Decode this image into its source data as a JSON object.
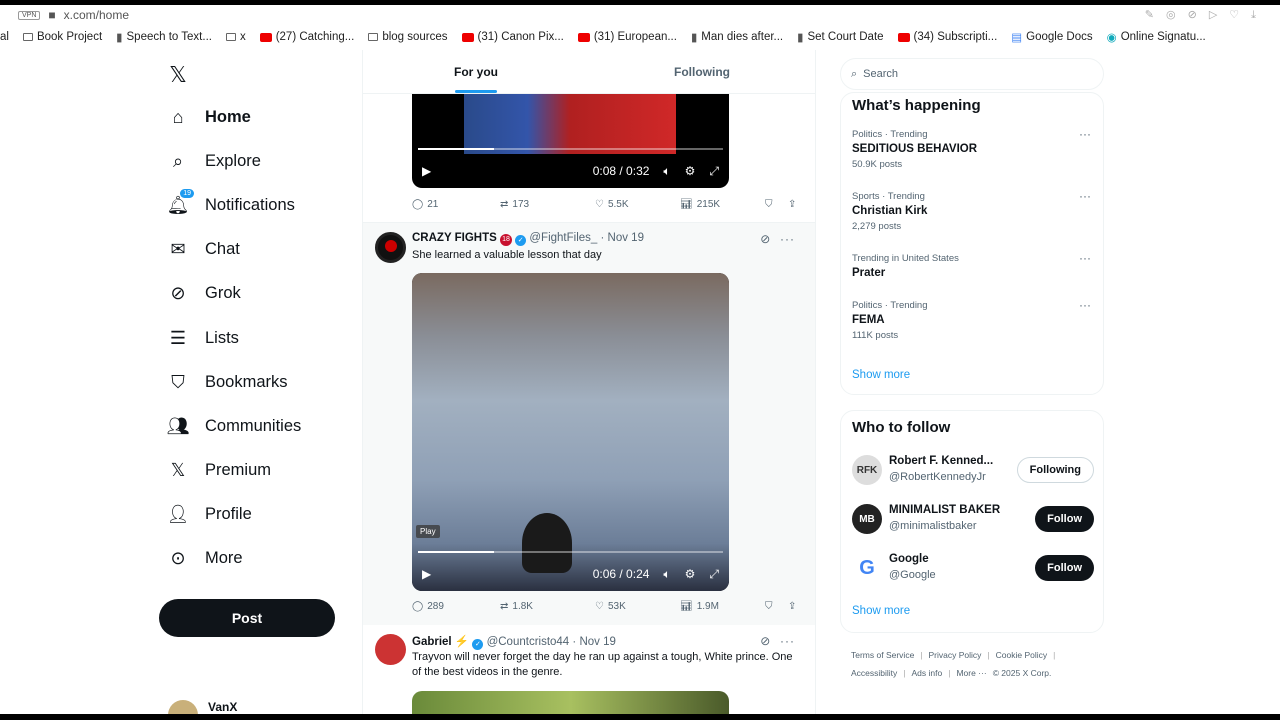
{
  "browser": {
    "url": "x.com/home",
    "vpn": "VPN",
    "bookmarks": [
      {
        "label": "al",
        "icon": "none"
      },
      {
        "label": "Book Project",
        "icon": "folder"
      },
      {
        "label": "Speech to Text...",
        "icon": "page"
      },
      {
        "label": "x",
        "icon": "folder"
      },
      {
        "label": "(27) Catching...",
        "icon": "youtube"
      },
      {
        "label": "blog sources",
        "icon": "folder"
      },
      {
        "label": "(31) Canon Pix...",
        "icon": "youtube"
      },
      {
        "label": "(31) European...",
        "icon": "youtube"
      },
      {
        "label": "Man dies after...",
        "icon": "news"
      },
      {
        "label": "Set Court Date",
        "icon": "doc"
      },
      {
        "label": "(34) Subscripti...",
        "icon": "youtube"
      },
      {
        "label": "Google Docs",
        "icon": "docs"
      },
      {
        "label": "Online Signatu...",
        "icon": "sign"
      }
    ]
  },
  "nav": {
    "items": [
      {
        "label": "Home",
        "icon": "home-icon",
        "glyph": "⌂"
      },
      {
        "label": "Explore",
        "icon": "search-icon",
        "glyph": "⌕"
      },
      {
        "label": "Notifications",
        "icon": "bell-icon",
        "glyph": "🔔︎",
        "badge": "19"
      },
      {
        "label": "Chat",
        "icon": "mail-icon",
        "glyph": "✉"
      },
      {
        "label": "Grok",
        "icon": "grok-icon",
        "glyph": "⊘"
      },
      {
        "label": "Lists",
        "icon": "list-icon",
        "glyph": "☰"
      },
      {
        "label": "Bookmarks",
        "icon": "bookmark-icon",
        "glyph": "⛉"
      },
      {
        "label": "Communities",
        "icon": "people-icon",
        "glyph": "👥︎"
      },
      {
        "label": "Premium",
        "icon": "x-icon",
        "glyph": "𝕏"
      },
      {
        "label": "Profile",
        "icon": "person-icon",
        "glyph": "👤︎"
      },
      {
        "label": "More",
        "icon": "more-circle-icon",
        "glyph": "⊙"
      }
    ],
    "post_label": "Post",
    "user": "VanX"
  },
  "feed": {
    "tabs": [
      "For you",
      "Following"
    ],
    "tweets": [
      {
        "video": {
          "time": "0:08 / 0:32",
          "progress": 0.25
        },
        "stats": {
          "replies": "21",
          "reposts": "173",
          "likes": "5.5K",
          "views": "215K"
        }
      },
      {
        "name": "CRAZY FIGHTS",
        "badge": "18",
        "handle": "@FightFiles_",
        "date": "· Nov 19",
        "text": "She learned a valuable lesson that day",
        "video": {
          "time": "0:06 / 0:24",
          "progress": 0.25,
          "tooltip": "Play"
        },
        "stats": {
          "replies": "289",
          "reposts": "1.8K",
          "likes": "53K",
          "views": "1.9M"
        }
      },
      {
        "name": "Gabriel",
        "emoji": "⚡",
        "handle": "@Countcristo44",
        "date": "· Nov 19",
        "text": "Trayvon will never forget the day he ran up against a tough, White prince. One of the best videos in the genre."
      }
    ]
  },
  "right": {
    "search_placeholder": "Search",
    "happening_title": "What’s happening",
    "trends": [
      {
        "context": "Politics · Trending",
        "title": "SEDITIOUS BEHAVIOR",
        "posts": "50.9K posts"
      },
      {
        "context": "Sports · Trending",
        "title": "Christian Kirk",
        "posts": "2,279 posts"
      },
      {
        "context": "Trending in United States",
        "title": "Prater",
        "posts": ""
      },
      {
        "context": "Politics · Trending",
        "title": "FEMA",
        "posts": "111K posts"
      }
    ],
    "show_more": "Show more",
    "who_title": "Who to follow",
    "follow": [
      {
        "name": "Robert F. Kenned...",
        "handle": "@RobertKennedyJr",
        "button": "Following",
        "avatar": "RFK"
      },
      {
        "name": "MINIMALIST BAKER",
        "handle": "@minimalistbaker",
        "button": "Follow",
        "avatar": "MB"
      },
      {
        "name": "Google",
        "handle": "@Google",
        "button": "Follow",
        "avatar": "G"
      }
    ],
    "footer": [
      "Terms of Service",
      "Privacy Policy",
      "Cookie Policy",
      "Accessibility",
      "Ads info",
      "More ···",
      "© 2025 X Corp."
    ]
  }
}
